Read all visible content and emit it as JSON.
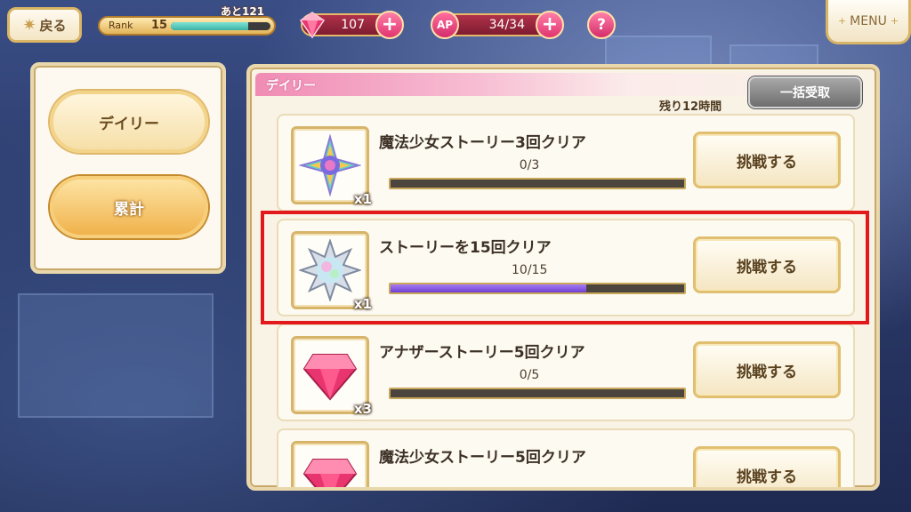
{
  "topbar": {
    "back_label": "戻る",
    "rank_label": "Rank",
    "rank_value": "15",
    "rank_next": "あと121",
    "rank_progress": 0.78,
    "gems": "107",
    "ap_label": "AP",
    "ap": "34/34",
    "help": "?",
    "menu_label": "MENU"
  },
  "sidebar": {
    "tabs": [
      {
        "label": "デイリー",
        "active": false
      },
      {
        "label": "累計",
        "active": true
      }
    ]
  },
  "panel": {
    "title": "デイリー",
    "remaining": "残り12時間",
    "bulk_receive": "一括受取"
  },
  "missions": [
    {
      "title": "魔法少女ストーリー3回クリア",
      "progress_text": "0/3",
      "progress": 0.0,
      "reward_icon": "rainbow-star-icon",
      "reward_qty": "x1",
      "button": "挑戦する"
    },
    {
      "title": "ストーリーを15回クリア",
      "progress_text": "10/15",
      "progress": 0.667,
      "reward_icon": "silver-star-icon",
      "reward_qty": "x1",
      "button": "挑戦する"
    },
    {
      "title": "アナザーストーリー5回クリア",
      "progress_text": "0/5",
      "progress": 0.0,
      "reward_icon": "pink-gem-icon",
      "reward_qty": "x3",
      "button": "挑戦する"
    },
    {
      "title": "魔法少女ストーリー5回クリア",
      "progress_text": "",
      "progress": 0.0,
      "reward_icon": "pink-gem-icon",
      "reward_qty": "",
      "button": "挑戦する"
    }
  ]
}
